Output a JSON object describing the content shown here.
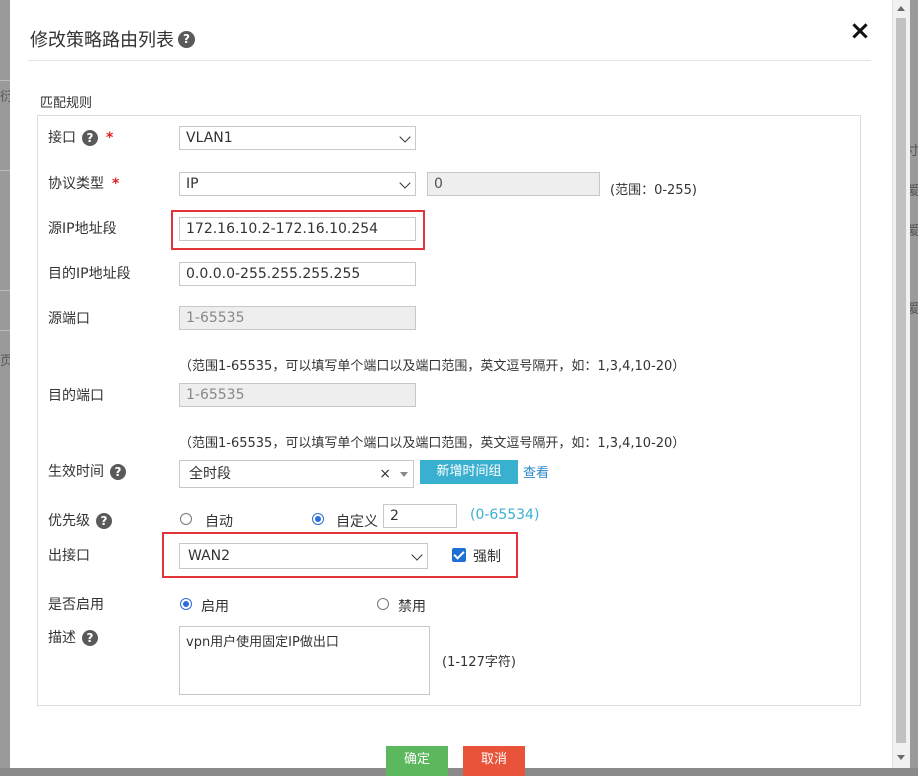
{
  "background": {
    "left_fragments": [
      "衍",
      "页"
    ],
    "right_fragments": [
      "寸",
      "爱",
      "爱",
      "爱"
    ]
  },
  "dialog": {
    "title": "修改策略路由列表",
    "close": "×"
  },
  "section_label": "匹配规则",
  "form": {
    "interface": {
      "label": "接口",
      "value": "VLAN1"
    },
    "protocol": {
      "label": "协议类型",
      "value": "IP",
      "number": "0",
      "range_hint": "(范围：0-255)"
    },
    "src_ip": {
      "label": "源IP地址段",
      "value": "172.16.10.2-172.16.10.254"
    },
    "dst_ip": {
      "label": "目的IP地址段",
      "value": "0.0.0.0-255.255.255.255"
    },
    "src_port": {
      "label": "源端口",
      "placeholder": "1-65535",
      "hint": "（范围1-65535，可以填写单个端口以及端口范围，英文逗号隔开，如：1,3,4,10-20）"
    },
    "dst_port": {
      "label": "目的端口",
      "placeholder": "1-65535",
      "hint": "（范围1-65535，可以填写单个端口以及端口范围，英文逗号隔开，如：1,3,4,10-20）"
    },
    "schedule": {
      "label": "生效时间",
      "value": "全时段",
      "clear": "×",
      "new_button": "新增时间组",
      "view_link": "查看"
    },
    "priority": {
      "label": "优先级",
      "auto": "自动",
      "custom": "自定义",
      "value": "2",
      "range_hint": "(0-65534)"
    },
    "out_interface": {
      "label": "出接口",
      "value": "WAN2",
      "force_label": "强制"
    },
    "enable": {
      "label": "是否启用",
      "on": "启用",
      "off": "禁用"
    },
    "description": {
      "label": "描述",
      "value": "vpn用户使用固定IP做出口",
      "hint": "(1-127字符)"
    }
  },
  "required_mark": "*",
  "help_mark": "?",
  "buttons": {
    "confirm": "确定",
    "cancel": "取消"
  },
  "colors": {
    "accent": "#3ab0d0",
    "confirm": "#5cb85c",
    "cancel": "#e8533a",
    "highlight": "#e0333a",
    "radio_checkbox": "#1f6fd6"
  }
}
